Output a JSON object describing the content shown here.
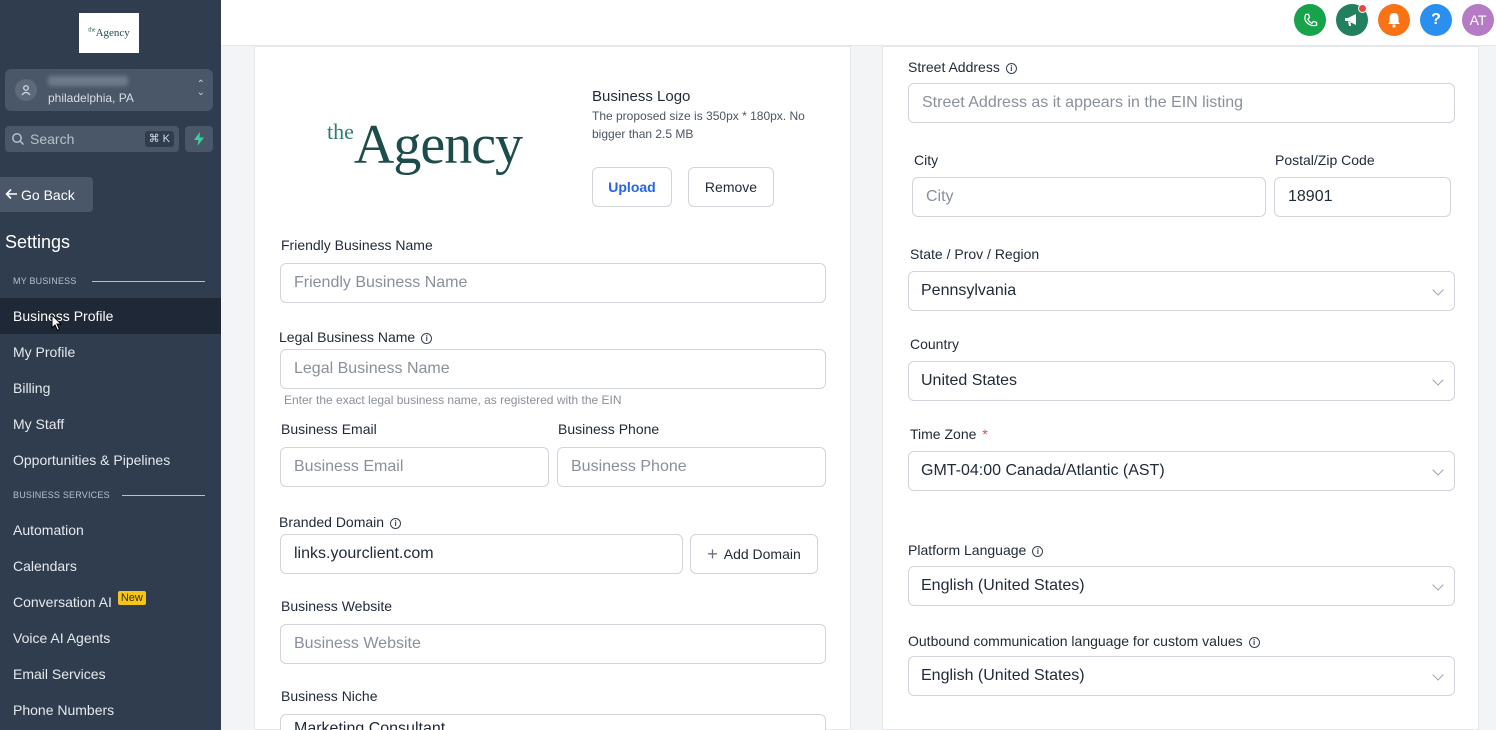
{
  "sidebar": {
    "logo_text_small": "the",
    "logo_text": "Agency",
    "location_city": "philadelphia, PA",
    "search_placeholder": "Search",
    "search_shortcut": "⌘ K",
    "go_back": "Go Back",
    "settings_title": "Settings",
    "section_my_business": "MY BUSINESS",
    "section_business_services": "BUSINESS SERVICES",
    "items": [
      {
        "label": "Business Profile",
        "active": true
      },
      {
        "label": "My Profile"
      },
      {
        "label": "Billing"
      },
      {
        "label": "My Staff"
      },
      {
        "label": "Opportunities & Pipelines"
      }
    ],
    "services_items": [
      {
        "label": "Automation"
      },
      {
        "label": "Calendars"
      },
      {
        "label": "Conversation AI",
        "badge": "New"
      },
      {
        "label": "Voice AI Agents"
      },
      {
        "label": "Email Services"
      },
      {
        "label": "Phone Numbers"
      }
    ]
  },
  "topbar": {
    "avatar_initials": "AT",
    "help_symbol": "?",
    "colors": {
      "phone": "#16a34a",
      "megaphone": "#22805f",
      "bell": "#f97316",
      "help": "#2b8ff0",
      "avatar": "#b57bc4"
    }
  },
  "left_card": {
    "logo_small": "the",
    "logo_main": "Agency",
    "business_logo_title": "Business Logo",
    "business_logo_hint": "The proposed size is 350px * 180px. No bigger than 2.5 MB",
    "upload_label": "Upload",
    "remove_label": "Remove",
    "friendly_name_label": "Friendly Business Name",
    "friendly_name_placeholder": "Friendly Business Name",
    "legal_name_label": "Legal Business Name",
    "legal_name_placeholder": "Legal Business Name",
    "legal_name_helper": "Enter the exact legal business name, as registered with the EIN",
    "email_label": "Business Email",
    "email_placeholder": "Business Email",
    "phone_label": "Business Phone",
    "phone_placeholder": "Business Phone",
    "domain_label": "Branded Domain",
    "domain_value": "links.yourclient.com",
    "add_domain_label": "Add Domain",
    "website_label": "Business Website",
    "website_placeholder": "Business Website",
    "niche_label": "Business Niche",
    "niche_value": "Marketing Consultant"
  },
  "right_card": {
    "street_label": "Street Address",
    "street_placeholder": "Street Address as it appears in the EIN listing",
    "city_label": "City",
    "city_placeholder": "City",
    "zip_label": "Postal/Zip Code",
    "zip_value": "18901",
    "state_label": "State / Prov / Region",
    "state_value": "Pennsylvania",
    "country_label": "Country",
    "country_value": "United States",
    "timezone_label": "Time Zone",
    "timezone_required": "*",
    "timezone_value": "GMT-04:00 Canada/Atlantic (AST)",
    "platform_lang_label": "Platform Language",
    "platform_lang_value": "English (United States)",
    "outbound_lang_label": "Outbound communication language for custom values",
    "outbound_lang_value": "English (United States)"
  }
}
